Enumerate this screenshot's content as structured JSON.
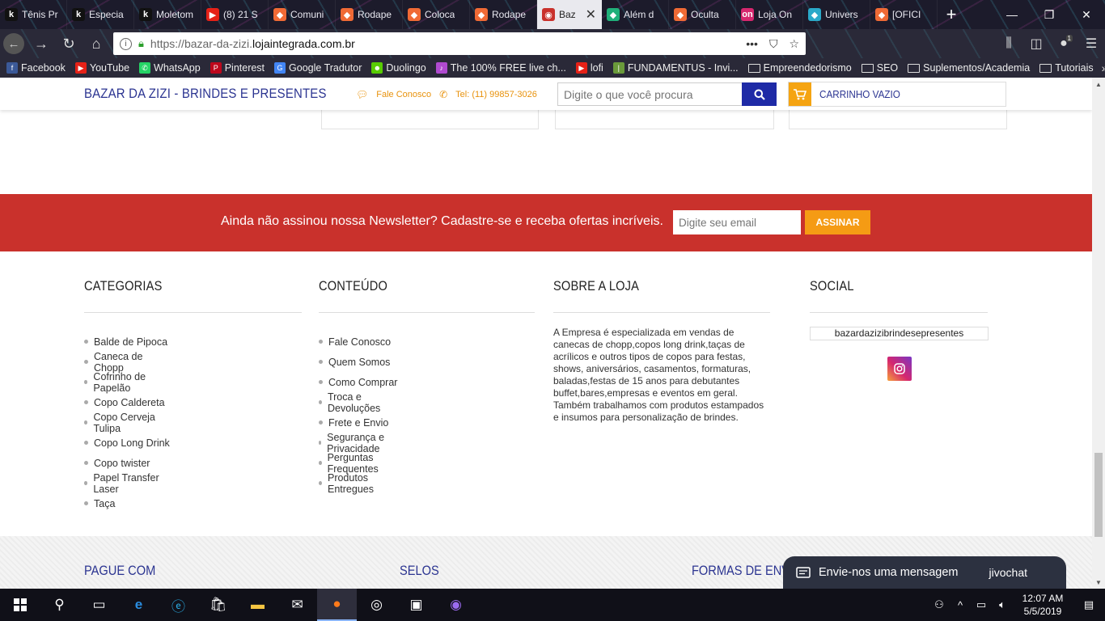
{
  "browser": {
    "tabs": [
      {
        "label": "Tênis Pr",
        "fav": "k",
        "color": "#111"
      },
      {
        "label": "Especia",
        "fav": "k",
        "color": "#111"
      },
      {
        "label": "Moletom",
        "fav": "k",
        "color": "#111"
      },
      {
        "label": "(8) 21 S",
        "fav": "▶",
        "color": "#e62117"
      },
      {
        "label": "Comuni",
        "fav": "◆",
        "color": "#f06a35"
      },
      {
        "label": "Rodape",
        "fav": "◆",
        "color": "#f06a35"
      },
      {
        "label": "Coloca",
        "fav": "◆",
        "color": "#f06a35"
      },
      {
        "label": "Rodape",
        "fav": "◆",
        "color": "#f06a35"
      },
      {
        "label": "Baz",
        "fav": "◉",
        "color": "#c9312c",
        "active": true
      },
      {
        "label": "Além d",
        "fav": "◆",
        "color": "#20b07a"
      },
      {
        "label": "Oculta",
        "fav": "◆",
        "color": "#f06a35"
      },
      {
        "label": "Loja On",
        "fav": "on",
        "color": "#d6276e"
      },
      {
        "label": "Univers",
        "fav": "◆",
        "color": "#2aa9c9"
      },
      {
        "label": "[OFICI",
        "fav": "◆",
        "color": "#f06a35"
      }
    ],
    "url_prefix": "https://bazar-da-zizi.",
    "url_domain": "lojaintegrada.com.br",
    "bookmarks": [
      {
        "label": "Facebook",
        "color": "#3b5998",
        "glyph": "f"
      },
      {
        "label": "YouTube",
        "color": "#e62117",
        "glyph": "▶"
      },
      {
        "label": "WhatsApp",
        "color": "#25d366",
        "glyph": "✆"
      },
      {
        "label": "Pinterest",
        "color": "#bd081c",
        "glyph": "P"
      },
      {
        "label": "Google Tradutor",
        "color": "#4285f4",
        "glyph": "G"
      },
      {
        "label": "Duolingo",
        "color": "#58cc02",
        "glyph": "☻"
      },
      {
        "label": "The 100% FREE live ch...",
        "color": "#b04ad0",
        "glyph": "♪"
      },
      {
        "label": "lofi",
        "color": "#e62117",
        "glyph": "▶"
      },
      {
        "label": "FUNDAMENTUS - Invi...",
        "color": "#6a9a3a",
        "glyph": "|"
      },
      {
        "label": "Empreendedorismo",
        "folder": true
      },
      {
        "label": "SEO",
        "folder": true
      },
      {
        "label": "Suplementos/Academia",
        "folder": true
      },
      {
        "label": "Tutoriais",
        "folder": true
      }
    ],
    "bookmarks_more": "»",
    "badge_count": "1"
  },
  "header": {
    "store_name": "BAZAR DA ZIZI - BRINDES E PRESENTES",
    "contact_label": "Fale Conosco",
    "phone_label": "Tel: (11) 99857-3026",
    "search_placeholder": "Digite o que você procura",
    "cart_label": "CARRINHO VAZIO"
  },
  "newsletter": {
    "text": "Ainda não assinou nossa Newsletter? Cadastre-se e receba ofertas incríveis.",
    "email_placeholder": "Digite seu email",
    "button": "ASSINAR"
  },
  "footer": {
    "categories": {
      "title": "CATEGORIAS",
      "items": [
        "Balde de Pipoca",
        "Caneca de Chopp",
        "Cofrinho de Papelão",
        "Copo Caldereta",
        "Copo Cerveja Tulipa",
        "Copo Long Drink",
        "Copo twister",
        "Papel Transfer Laser",
        "Taça"
      ]
    },
    "content": {
      "title": "CONTEÚDO",
      "items": [
        "Fale Conosco",
        "Quem Somos",
        "Como Comprar",
        "Troca e Devoluções",
        "Frete e Envio",
        "Segurança e Privacidade",
        "Perguntas Frequentes",
        "Produtos Entregues"
      ]
    },
    "about": {
      "title": "SOBRE A LOJA",
      "text": "A Empresa é especializada em vendas de canecas de chopp,copos long drink,taças de acrílicos e outros tipos de copos para festas, shows, aniversários, casamentos, formaturas, baladas,festas de 15 anos para debutantes buffet,bares,empresas e eventos em geral. Também trabalhamos com produtos estampados e insumos para personalização de brindes."
    },
    "social": {
      "title": "SOCIAL",
      "handle": "bazardazizibrindesepresentes"
    },
    "bottom": {
      "pay": "PAGUE COM",
      "seals": "SELOS",
      "shipping": "FORMAS DE ENVIO"
    }
  },
  "chat": {
    "label": "Envie-nos uma mensagem",
    "brand": "jivochat"
  },
  "taskbar": {
    "time": "12:07 AM",
    "date": "5/5/2019"
  }
}
